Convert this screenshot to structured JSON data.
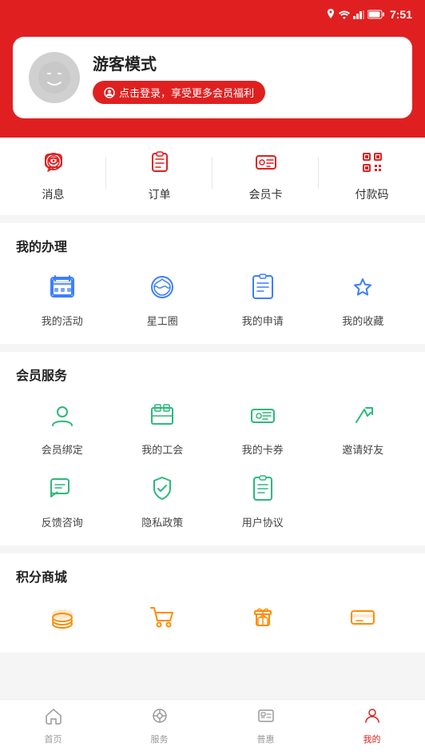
{
  "statusBar": {
    "time": "7:51"
  },
  "profile": {
    "name": "游客模式",
    "loginBtn": "点击登录，享受更多会员福利",
    "avatarAlt": "guest-avatar"
  },
  "quickActions": [
    {
      "id": "message",
      "label": "消息",
      "icon": "chat"
    },
    {
      "id": "order",
      "label": "订单",
      "icon": "order"
    },
    {
      "id": "membercard",
      "label": "会员卡",
      "icon": "card"
    },
    {
      "id": "paycode",
      "label": "付款码",
      "icon": "qr"
    }
  ],
  "mySection": {
    "title": "我的办理",
    "items": [
      {
        "id": "my-activity",
        "label": "我的活动",
        "icon": "activity"
      },
      {
        "id": "star-circle",
        "label": "星工圈",
        "icon": "star-circle"
      },
      {
        "id": "my-apply",
        "label": "我的申请",
        "icon": "apply"
      },
      {
        "id": "my-collect",
        "label": "我的收藏",
        "icon": "collect"
      }
    ]
  },
  "memberSection": {
    "title": "会员服务",
    "items": [
      {
        "id": "member-bind",
        "label": "会员绑定",
        "icon": "member-bind"
      },
      {
        "id": "my-union",
        "label": "我的工会",
        "icon": "union"
      },
      {
        "id": "my-coupon",
        "label": "我的卡券",
        "icon": "coupon"
      },
      {
        "id": "invite-friend",
        "label": "邀请好友",
        "icon": "invite"
      },
      {
        "id": "feedback",
        "label": "反馈咨询",
        "icon": "feedback"
      },
      {
        "id": "privacy",
        "label": "隐私政策",
        "icon": "privacy"
      },
      {
        "id": "agreement",
        "label": "用户协议",
        "icon": "agreement"
      }
    ]
  },
  "pointsSection": {
    "title": "积分商城",
    "items": [
      {
        "id": "coins",
        "label": "",
        "icon": "coins"
      },
      {
        "id": "cart",
        "label": "",
        "icon": "cart"
      },
      {
        "id": "gift",
        "label": "",
        "icon": "gift"
      },
      {
        "id": "voucher",
        "label": "",
        "icon": "voucher"
      }
    ]
  },
  "bottomNav": {
    "items": [
      {
        "id": "home",
        "label": "首页",
        "icon": "home",
        "active": false
      },
      {
        "id": "service",
        "label": "服务",
        "icon": "service",
        "active": false
      },
      {
        "id": "benefits",
        "label": "普惠",
        "icon": "benefits",
        "active": false
      },
      {
        "id": "mine",
        "label": "我的",
        "icon": "mine",
        "active": true
      }
    ]
  }
}
